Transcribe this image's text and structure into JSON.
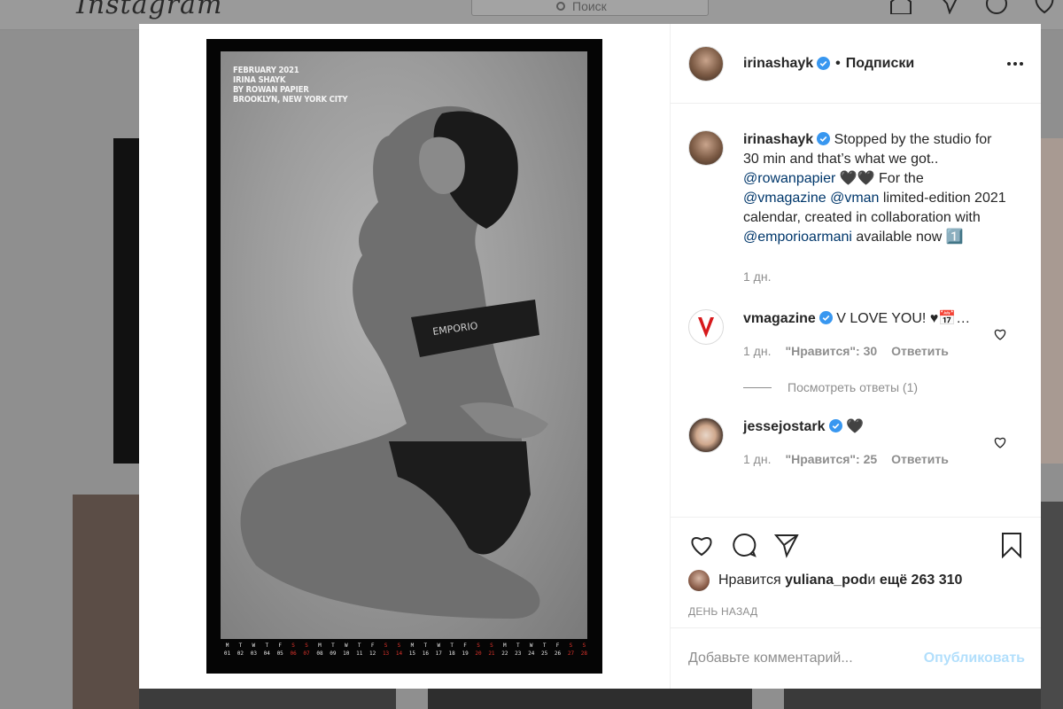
{
  "background": {
    "logo": "Instagram",
    "search_placeholder": "Поиск"
  },
  "post": {
    "author": "irinashayk",
    "separator": "•",
    "follow_status": "Подписки",
    "photo_text": [
      "February 2021",
      "Irina Shayk",
      "by Rowan Papier",
      "Brooklyn, New York City"
    ],
    "calendar": [
      {
        "d": "M",
        "n": "01",
        "we": false
      },
      {
        "d": "T",
        "n": "02",
        "we": false
      },
      {
        "d": "W",
        "n": "03",
        "we": false
      },
      {
        "d": "T",
        "n": "04",
        "we": false
      },
      {
        "d": "F",
        "n": "05",
        "we": false
      },
      {
        "d": "S",
        "n": "06",
        "we": true
      },
      {
        "d": "S",
        "n": "07",
        "we": true
      },
      {
        "d": "M",
        "n": "08",
        "we": false
      },
      {
        "d": "T",
        "n": "09",
        "we": false
      },
      {
        "d": "W",
        "n": "10",
        "we": false
      },
      {
        "d": "T",
        "n": "11",
        "we": false
      },
      {
        "d": "F",
        "n": "12",
        "we": false
      },
      {
        "d": "S",
        "n": "13",
        "we": true
      },
      {
        "d": "S",
        "n": "14",
        "we": true
      },
      {
        "d": "M",
        "n": "15",
        "we": false
      },
      {
        "d": "T",
        "n": "16",
        "we": false
      },
      {
        "d": "W",
        "n": "17",
        "we": false
      },
      {
        "d": "T",
        "n": "18",
        "we": false
      },
      {
        "d": "F",
        "n": "19",
        "we": false
      },
      {
        "d": "S",
        "n": "20",
        "we": true
      },
      {
        "d": "S",
        "n": "21",
        "we": true
      },
      {
        "d": "M",
        "n": "22",
        "we": false
      },
      {
        "d": "T",
        "n": "23",
        "we": false
      },
      {
        "d": "W",
        "n": "24",
        "we": false
      },
      {
        "d": "T",
        "n": "25",
        "we": false
      },
      {
        "d": "F",
        "n": "26",
        "we": false
      },
      {
        "d": "S",
        "n": "27",
        "we": true
      },
      {
        "d": "S",
        "n": "28",
        "we": true
      }
    ]
  },
  "caption": {
    "user": "irinashayk",
    "t1": " Stopped by the studio for 30 min and that’s what we got.. ",
    "m1": "@rowanpapier",
    "t2": " 🖤🖤 For the ",
    "m2": "@vmagazine",
    "t3": " ",
    "m3": "@vman",
    "t4": " limited-edition 2021 calendar, created in collaboration with ",
    "m4": "@emporioarmani",
    "t5": " available now 1️⃣",
    "time": "1 дн."
  },
  "comments": [
    {
      "user": "vmagazine",
      "text": " V LOVE YOU! ♥📅…",
      "time": "1 дн.",
      "likes": "\"Нравится\": 30",
      "reply": "Ответить",
      "view_replies": "Посмотреть ответы (1)"
    },
    {
      "user": "jessejostark",
      "text": " 🖤",
      "time": "1 дн.",
      "likes": "\"Нравится\": 25",
      "reply": "Ответить"
    }
  ],
  "likes_line": {
    "prefix": "Нравится ",
    "user": "yuliana_pod",
    "middle": " и ",
    "count": "ещё 263 310"
  },
  "post_date": "День назад",
  "comment_box": {
    "placeholder": "Добавьте комментарий...",
    "publish": "Опубликовать"
  },
  "colors": {
    "verified": "#3897f0",
    "mention": "#00376b",
    "publish_disabled": "#b2dffc",
    "calendar_weekend": "#e0342c"
  }
}
